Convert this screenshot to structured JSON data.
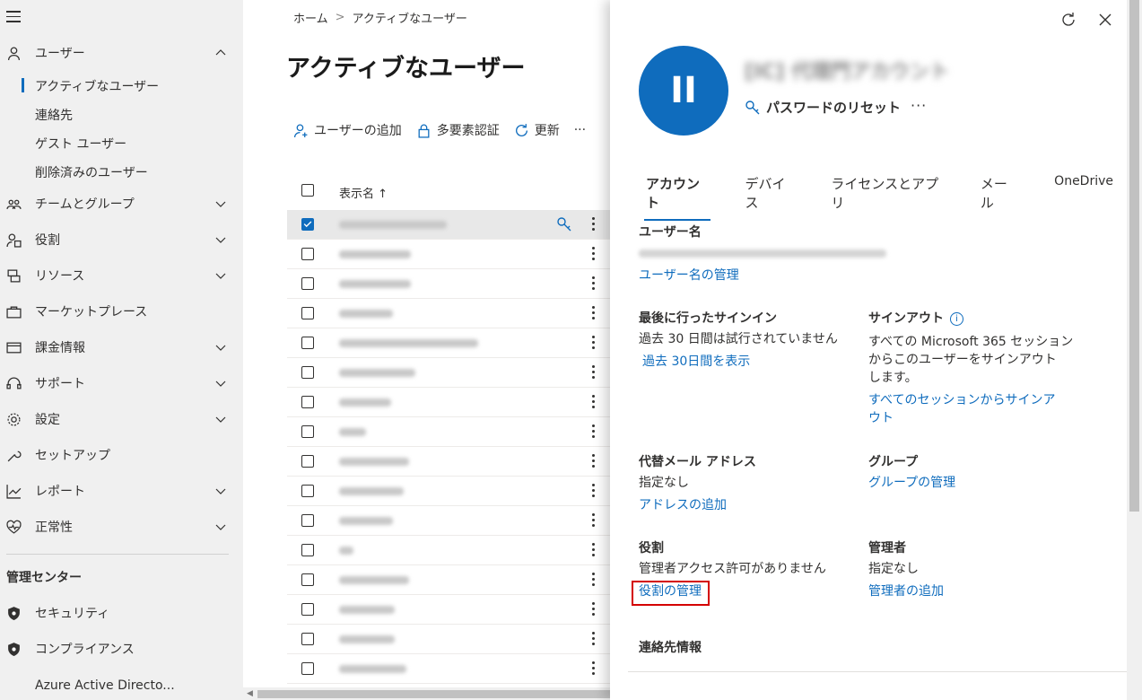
{
  "sidebar": {
    "items": [
      {
        "label": "ユーザー",
        "icon": "user-icon",
        "chevron": "up"
      },
      {
        "label": "チームとグループ",
        "icon": "team-icon",
        "chevron": "down"
      },
      {
        "label": "役割",
        "icon": "role-icon",
        "chevron": "down"
      },
      {
        "label": "リソース",
        "icon": "resource-icon",
        "chevron": "down"
      },
      {
        "label": "マーケットプレース",
        "icon": "marketplace-icon",
        "chevron": null
      },
      {
        "label": "課金情報",
        "icon": "billing-icon",
        "chevron": "down"
      },
      {
        "label": "サポート",
        "icon": "headset-icon",
        "chevron": "down"
      },
      {
        "label": "設定",
        "icon": "gear-icon",
        "chevron": "down"
      },
      {
        "label": "セットアップ",
        "icon": "wrench-icon",
        "chevron": null
      },
      {
        "label": "レポート",
        "icon": "chart-icon",
        "chevron": "down"
      },
      {
        "label": "正常性",
        "icon": "heart-icon",
        "chevron": "down"
      }
    ],
    "sub_items": [
      "アクティブなユーザー",
      "連絡先",
      "ゲスト ユーザー",
      "削除済みのユーザー"
    ],
    "admin_centers_title": "管理センター",
    "admin_centers": [
      "セキュリティ",
      "コンプライアンス",
      "Azure Active Directo..."
    ]
  },
  "breadcrumb": {
    "home": "ホーム",
    "separator": ">",
    "current": "アクティブなユーザー"
  },
  "page_title": "アクティブなユーザー",
  "commands": {
    "add_user": "ユーザーの追加",
    "mfa": "多要素認証",
    "refresh": "更新",
    "more": "···"
  },
  "table": {
    "header_display_name": "表示名 ↑",
    "row_count": 16,
    "selected_row": 0
  },
  "panel": {
    "avatar_initials": "II",
    "display_name": "[IC] 代理門アカウント",
    "reset_password": "パスワードのリセット",
    "more": "···",
    "tabs": [
      "アカウント",
      "デバイス",
      "ライセンスとアプリ",
      "メール",
      "OneDrive"
    ],
    "username_label": "ユーザー名",
    "username_manage": "ユーザー名の管理",
    "last_signin_label": "最後に行ったサインイン",
    "last_signin_value": "過去 30 日間は試行されていません",
    "last_signin_link": "過去 30日間を表示",
    "signout_label": "サインアウト",
    "signout_info": "i",
    "signout_desc_1": "すべての Microsoft 365 セッション",
    "signout_desc_2": "からこのユーザーをサインアウト",
    "signout_desc_3": "します。",
    "signout_link_1": "すべてのセッションからサインア",
    "signout_link_2": "ウト",
    "alt_email_label": "代替メール アドレス",
    "alt_email_value": "指定なし",
    "alt_email_link": "アドレスの追加",
    "groups_label": "グループ",
    "groups_link": "グループの管理",
    "roles_label": "役割",
    "roles_value": "管理者アクセス許可がありません",
    "roles_link": "役割の管理",
    "manager_label": "管理者",
    "manager_value": "指定なし",
    "manager_link": "管理者の追加",
    "contact_label": "連絡先情報"
  },
  "colors": {
    "accent": "#0f6cbd",
    "highlight": "#d40000",
    "sidebar_bg": "#f0f0f0"
  }
}
